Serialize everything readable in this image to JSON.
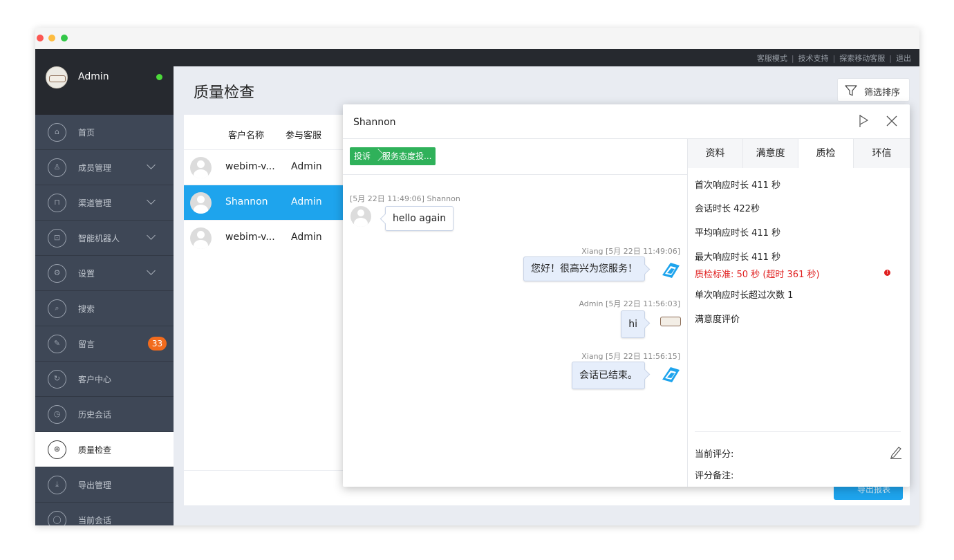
{
  "window": {
    "traffic_lights": [
      "close",
      "minimize",
      "zoom"
    ]
  },
  "topbar": {
    "links": [
      "客服模式",
      "技术支持",
      "探索移动客服",
      "退出"
    ],
    "separator": "|"
  },
  "user": {
    "name": "Admin",
    "status_color": "#4cd93a"
  },
  "sidebar": {
    "items": [
      {
        "label": "首页",
        "icon": "home-icon",
        "glyph": "⌂",
        "chevron": false
      },
      {
        "label": "成员管理",
        "icon": "members-icon",
        "glyph": "♙",
        "chevron": true
      },
      {
        "label": "渠道管理",
        "icon": "channel-icon",
        "glyph": "⊓",
        "chevron": true
      },
      {
        "label": "智能机器人",
        "icon": "robot-icon",
        "glyph": "⊡",
        "chevron": true
      },
      {
        "label": "设置",
        "icon": "settings-icon",
        "glyph": "⚙",
        "chevron": true
      },
      {
        "label": "搜索",
        "icon": "search-icon",
        "glyph": "⌕",
        "chevron": false
      },
      {
        "label": "留言",
        "icon": "message-icon",
        "glyph": "✎",
        "chevron": false,
        "badge": "33"
      },
      {
        "label": "客户中心",
        "icon": "customer-center-icon",
        "glyph": "↻",
        "chevron": false
      },
      {
        "label": "历史会话",
        "icon": "history-icon",
        "glyph": "◷",
        "chevron": false
      },
      {
        "label": "质量检查",
        "icon": "quality-icon",
        "glyph": "⊕",
        "chevron": false,
        "active": true
      },
      {
        "label": "导出管理",
        "icon": "export-icon",
        "glyph": "⤓",
        "chevron": false
      },
      {
        "label": "当前会话",
        "icon": "current-session-icon",
        "glyph": "◯",
        "chevron": false
      }
    ]
  },
  "page": {
    "title": "质量检查",
    "filter_label": "筛选排序",
    "export_label": "导出报表"
  },
  "table": {
    "headers": [
      "客户名称",
      "参与客服"
    ],
    "rows": [
      {
        "customer": "webim-v...",
        "agent": "Admin",
        "selected": false
      },
      {
        "customer": "Shannon",
        "agent": "Admin",
        "selected": true
      },
      {
        "customer": "webim-v...",
        "agent": "Admin",
        "selected": false
      }
    ]
  },
  "modal": {
    "title": "Shannon",
    "tag": {
      "primary": "投诉",
      "secondary": "服务态度投..."
    },
    "messages": [
      {
        "meta": "[5月 22日 11:49:06] Shannon",
        "text": "hello again",
        "direction": "in"
      },
      {
        "meta": "Xiang [5月 22日 11:49:06]",
        "text": "您好！很高兴为您服务！",
        "direction": "out",
        "avatar": "agent-logo-icon"
      },
      {
        "meta": "Admin [5月 22日 11:56:03]",
        "text": "hi",
        "direction": "out",
        "avatar": "welcome-logo-icon"
      },
      {
        "meta": "Xiang [5月 22日 11:56:15]",
        "text": "会话已结束。",
        "direction": "out",
        "avatar": "agent-logo-icon"
      }
    ],
    "tabs": [
      "资料",
      "满意度",
      "质检",
      "环信"
    ],
    "active_tab": "质检",
    "stats": {
      "first_response": "首次响应时长 411 秒",
      "session_duration": "会话时长 422秒",
      "avg_response": "平均响应时长 411 秒",
      "max_response": "最大响应时长 411 秒",
      "qc_warning": "质检标准: 50 秒 (超时 361 秒)",
      "over_count": "单次响应时长超过次数 1",
      "satisfaction": "满意度评价"
    },
    "score_label": "当前评分:",
    "score_note_label": "评分备注:"
  },
  "colors": {
    "accent": "#1ea4ed",
    "tag_green": "#2fb15a",
    "badge_orange": "#f26b1d",
    "warning_red": "#e02020",
    "sidebar_bg": "#3e4756",
    "topbar_bg": "#26292f"
  }
}
